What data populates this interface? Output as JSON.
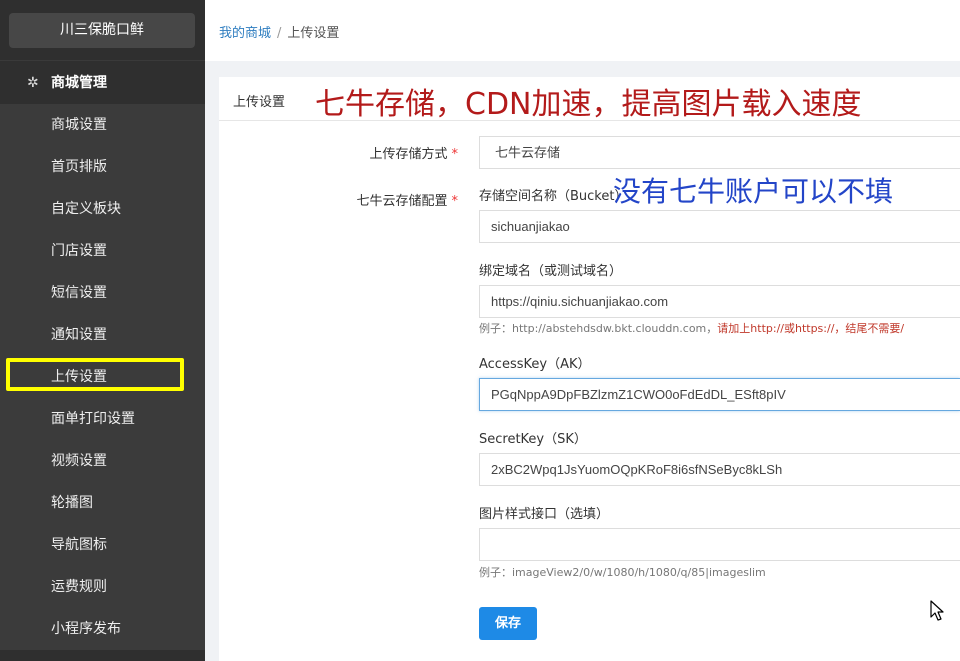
{
  "sidebar": {
    "brand": "川三保脆口鲜",
    "section_label": "商城管理",
    "items": [
      {
        "label": "商城设置"
      },
      {
        "label": "首页排版"
      },
      {
        "label": "自定义板块"
      },
      {
        "label": "门店设置"
      },
      {
        "label": "短信设置"
      },
      {
        "label": "通知设置"
      },
      {
        "label": "上传设置"
      },
      {
        "label": "面单打印设置"
      },
      {
        "label": "视频设置"
      },
      {
        "label": "轮播图"
      },
      {
        "label": "导航图标"
      },
      {
        "label": "运费规则"
      },
      {
        "label": "小程序发布"
      }
    ],
    "active_item": "上传设置",
    "highlight_color": "#ffff00"
  },
  "breadcrumb": {
    "home": "我的商城",
    "separator": "/",
    "current": "上传设置"
  },
  "panel": {
    "title": "上传设置",
    "annotation_red": "七牛存储，CDN加速，提高图片载入速度",
    "annotation_blue": "没有七牛账户可以不填"
  },
  "form": {
    "storage_method_label": "上传存储方式",
    "storage_method_value": "七牛云存储",
    "qiniu_config_label": "七牛云存储配置",
    "required_mark": "*",
    "bucket_label": "存储空间名称（Bucket）",
    "bucket_value": "sichuanjiakao",
    "domain_label": "绑定域名（或测试域名）",
    "domain_value": "https://qiniu.sichuanjiakao.com",
    "domain_hint_example": "例子：http://abstehdsdw.bkt.clouddn.com，",
    "domain_hint_warning": "请加上http://或https://，结尾不需要/",
    "ak_label": "AccessKey（AK）",
    "ak_value": "PGqNppA9DpFBZlzmZ1CWO0oFdEdDL_ESft8pIV",
    "sk_label": "SecretKey（SK）",
    "sk_value": "2xBC2Wpq1JsYuomOQpKRoF8i6sfNSeByc8kLSh",
    "style_label": "图片样式接口（选填）",
    "style_value": "",
    "style_hint": "例子：imageView2/0/w/1080/h/1080/q/85|imageslim",
    "save_label": "保存"
  },
  "colors": {
    "primary": "#1e8ae6",
    "annotation_red": "#b31a1a",
    "annotation_blue": "#2345c8"
  }
}
